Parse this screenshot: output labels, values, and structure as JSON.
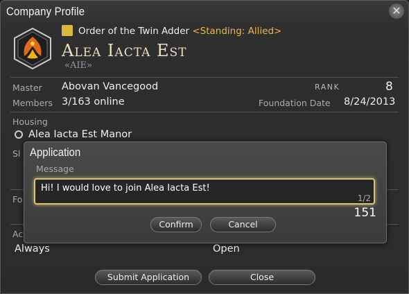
{
  "window": {
    "title": "Company Profile",
    "close_glyph": "✕"
  },
  "company": {
    "grand_company": "Order of the Twin Adder",
    "standing": "<Standing: Allied>",
    "name": "Alea Iacta Est",
    "tag": "«AIE»"
  },
  "info": {
    "master_label": "Master",
    "master_value": "Abovan Vancegood",
    "rank_label": "RANK",
    "rank_value": "8",
    "members_label": "Members",
    "members_value": "3/163 online",
    "foundation_label": "Foundation Date",
    "foundation_value": "8/24/2013",
    "housing_label": "Housing",
    "housing_value": "Alea Iacta Est Manor"
  },
  "partial_labels": {
    "sl": "Sl",
    "fo": "Fo",
    "ac": "Ac"
  },
  "bottom": {
    "always": "Always",
    "open": "Open",
    "submit_label": "Submit Application",
    "close_label": "Close"
  },
  "dialog": {
    "title": "Application",
    "message_label": "Message",
    "message_value": "Hi!  I would love to join Alea Iacta Est!",
    "page": "1/2",
    "remaining": "151",
    "confirm_label": "Confirm",
    "cancel_label": "Cancel"
  },
  "colors": {
    "accent_gold": "#e8b84a",
    "focus_glow": "#d6c57a"
  },
  "icons": {
    "crest": "twin-adder-crest-icon",
    "gc": "gc-emblem-icon",
    "search": "search-icon",
    "close": "close-icon"
  }
}
